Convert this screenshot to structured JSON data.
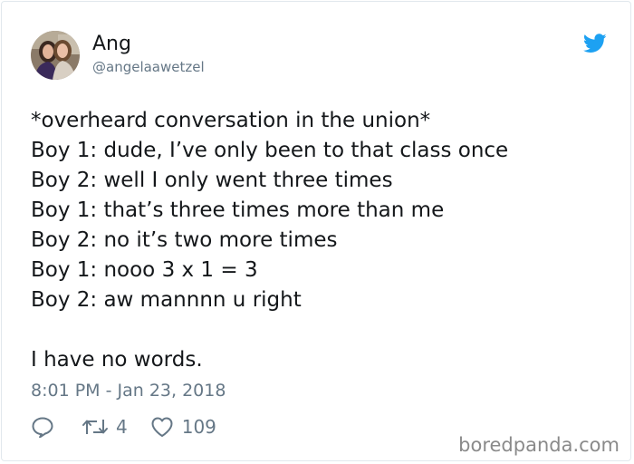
{
  "user": {
    "display_name": "Ang",
    "handle": "@angelaawetzel",
    "avatar_icon": "profile-photo"
  },
  "tweet": {
    "lines": [
      "*overheard conversation in the union*",
      "Boy 1: dude, I’ve only been to that class once",
      "Boy 2: well I only went three times",
      "Boy 1: that’s three times more than me",
      "Boy 2: no it’s two more times",
      "Boy 1: nooo 3 x 1 = 3",
      "Boy 2: aw mannnn u right",
      "I have no words."
    ],
    "timestamp": "8:01 PM - Jan 23, 2018"
  },
  "actions": {
    "reply_icon": "speech-bubble-icon",
    "retweet_icon": "retweet-icon",
    "retweet_count": "4",
    "like_icon": "heart-icon",
    "like_count": "109"
  },
  "brand": {
    "logo_icon": "twitter-bird-icon",
    "accent_color": "#1da1f2",
    "muted_color": "#657786"
  },
  "watermark": "boredpanda.com"
}
